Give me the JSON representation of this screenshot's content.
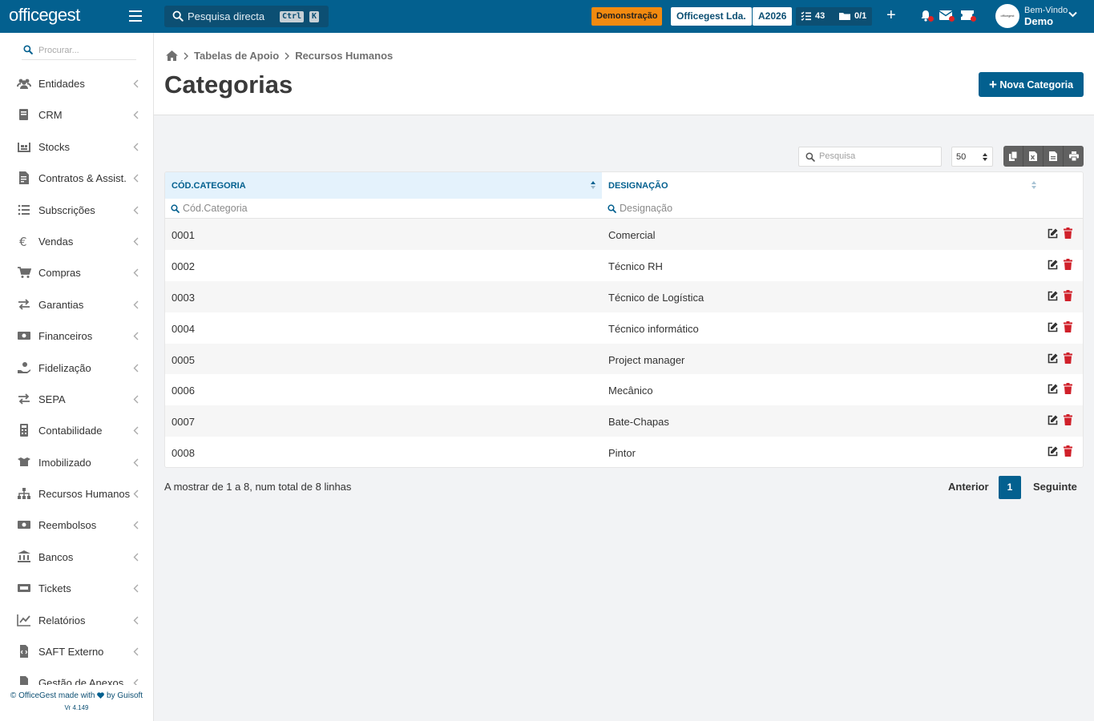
{
  "app": {
    "logo": "officegest",
    "search_label": "Pesquisa directa",
    "search_key1": "Ctrl",
    "search_key2": "K",
    "demo_badge": "Demonstração",
    "company": "Officegest Lda.",
    "year": "A2026",
    "tasks_count": "43",
    "docs_count": "0/1",
    "welcome": "Bem-Vindo",
    "user": "Demo",
    "avatar_text": "officegest",
    "colors": {
      "primary": "#03608f",
      "demo": "#f28a10",
      "delete": "#d0202a"
    }
  },
  "sidebar": {
    "search_placeholder": "Procurar...",
    "items": [
      {
        "label": "Entidades",
        "icon": "users-icon"
      },
      {
        "label": "CRM",
        "icon": "book-icon"
      },
      {
        "label": "Stocks",
        "icon": "warehouse-icon"
      },
      {
        "label": "Contratos & Assist.",
        "icon": "file-contract-icon"
      },
      {
        "label": "Subscrições",
        "icon": "list-icon"
      },
      {
        "label": "Vendas",
        "icon": "euro-icon"
      },
      {
        "label": "Compras",
        "icon": "cart-icon"
      },
      {
        "label": "Garantias",
        "icon": "exchange-icon"
      },
      {
        "label": "Financeiros",
        "icon": "money-bill-icon"
      },
      {
        "label": "Fidelização",
        "icon": "hand-coin-icon"
      },
      {
        "label": "SEPA",
        "icon": "exchange-icon"
      },
      {
        "label": "Contabilidade",
        "icon": "calculator-icon"
      },
      {
        "label": "Imobilizado",
        "icon": "box-open-icon"
      },
      {
        "label": "Recursos Humanos",
        "icon": "sitemap-icon"
      },
      {
        "label": "Reembolsos",
        "icon": "money-bill-icon"
      },
      {
        "label": "Bancos",
        "icon": "bank-icon"
      },
      {
        "label": "Tickets",
        "icon": "ticket-icon"
      },
      {
        "label": "Relatórios",
        "icon": "chart-icon"
      },
      {
        "label": "SAFT Externo",
        "icon": "file-code-icon"
      },
      {
        "label": "Gestão de Anexos",
        "icon": "file-icon"
      }
    ],
    "footer": "© OfficeGest made with",
    "footer_by": "by Guisoft",
    "version": "Vr 4.149"
  },
  "page": {
    "breadcrumb": [
      "Tabelas de Apoio",
      "Recursos Humanos"
    ],
    "title": "Categorias",
    "new_button": "Nova Categoria"
  },
  "table": {
    "search_placeholder": "Pesquisa",
    "page_size": "50",
    "columns": [
      "CÓD.CATEGORIA",
      "DESIGNAÇÃO"
    ],
    "filters": [
      "Cód.Categoria",
      "Designação"
    ],
    "rows": [
      [
        "0001",
        "Comercial"
      ],
      [
        "0002",
        "Técnico RH"
      ],
      [
        "0003",
        "Técnico de Logística"
      ],
      [
        "0004",
        "Técnico informático"
      ],
      [
        "0005",
        "Project manager"
      ],
      [
        "0006",
        "Mecânico"
      ],
      [
        "0007",
        "Bate-Chapas"
      ],
      [
        "0008",
        "Pintor"
      ]
    ]
  },
  "pagination": {
    "info": "A mostrar de 1 a 8, num total de 8 linhas",
    "prev": "Anterior",
    "current": "1",
    "next": "Seguinte"
  }
}
